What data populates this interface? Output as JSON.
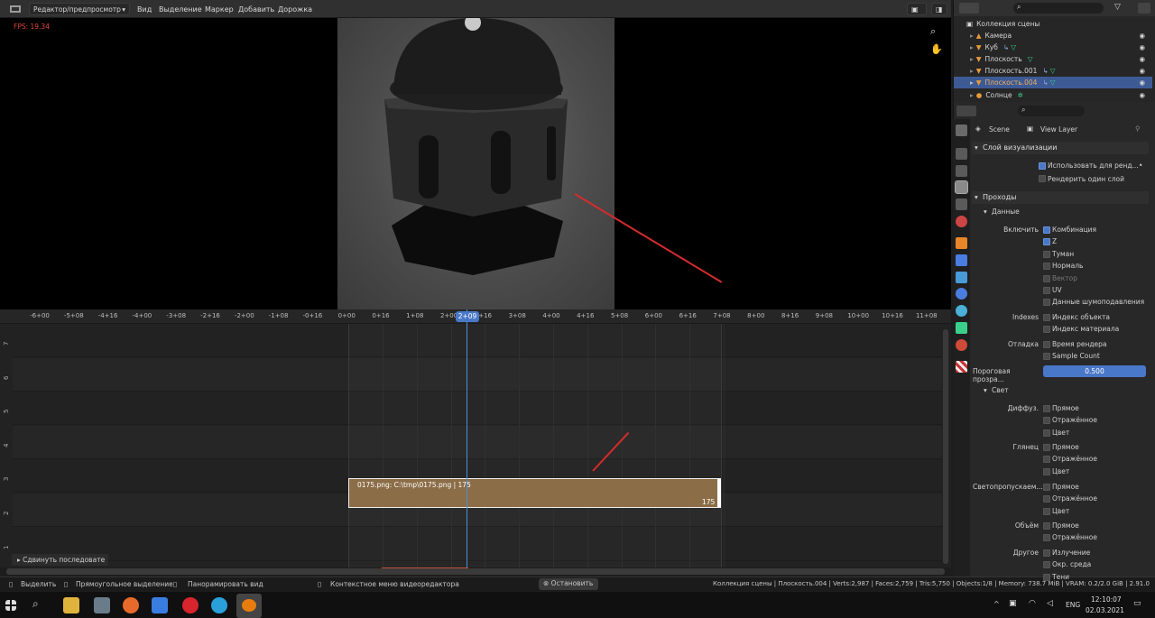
{
  "header": {
    "editor_mode": "Редактор/предпросмотр",
    "menu": [
      "Вид",
      "Выделение",
      "Маркер",
      "Добавить",
      "Дорожка"
    ]
  },
  "preview": {
    "fps": "FPS: 19.34"
  },
  "timeline": {
    "ticks": [
      "-6+00",
      "-5+08",
      "-4+16",
      "-4+00",
      "-3+08",
      "-2+16",
      "-2+00",
      "-1+08",
      "-0+16",
      "0+00",
      "0+16",
      "1+08",
      "2+00",
      "2+16",
      "3+08",
      "4+00",
      "4+16",
      "5+08",
      "6+00",
      "6+16",
      "7+08",
      "8+00",
      "8+16",
      "9+08",
      "10+00",
      "10+16",
      "11+08"
    ],
    "playhead": "2+09",
    "channels": [
      "7",
      "6",
      "5",
      "4",
      "3",
      "2",
      "1"
    ],
    "strip_label": "0175.png: C:\\tmp\\0175.png | 175",
    "strip_end": "175",
    "adjust_panel": "Сдвинуть последовате"
  },
  "status": {
    "select": "Выделить",
    "box": "Прямоугольное выделение",
    "pan": "Панорамировать вид",
    "context": "Контекстное меню видеоредактора",
    "stop": "Остановить",
    "stats": "Коллекция сцены | Плоскость.004 | Verts:2,987 | Faces:2,759 | Tris:5,750 | Objects:1/8 | Memory: 738.7 MiB | VRAM: 0.2/2.0 GiB | 2.91.0"
  },
  "taskbar": {
    "lang": "ENG",
    "time": "12:10:07",
    "date": "02.03.2021"
  },
  "outliner": {
    "root": "Коллекция сцены",
    "items": [
      "Камера",
      "Куб",
      "Плоскость",
      "Плоскость.001",
      "Плоскость.004",
      "Солнце"
    ],
    "selected": "Плоскость.004"
  },
  "properties": {
    "scene": "Scene",
    "view_layer": "View Layer",
    "sec_layer": "Слой визуализации",
    "use_render": "Использовать для ренд...",
    "render_single": "Рендерить один слой",
    "sec_passes": "Проходы",
    "sub_data": "Данные",
    "include": "Включить",
    "data_items": [
      "Комбинация",
      "Z",
      "Туман",
      "Нормаль",
      "Вектор",
      "UV",
      "Данные шумоподавления"
    ],
    "indexes": "Indexes",
    "index_items": [
      "Индекс объекта",
      "Индекс материала"
    ],
    "debug": "Отладка",
    "debug_items": [
      "Время рендера",
      "Sample Count"
    ],
    "alpha_label": "Пороговая прозра...",
    "alpha_value": "0.500",
    "sub_light": "Свет",
    "diffuse": "Диффуз.",
    "glossy": "Глянец",
    "transmission": "Светопропускаем...",
    "volume": "Объём",
    "other": "Другое",
    "light_items": [
      "Прямое",
      "Отражённое",
      "Цвет"
    ],
    "volume_items": [
      "Прямое",
      "Отражённое"
    ],
    "other_items": [
      "Излучение",
      "Окр. среда",
      "Тени"
    ]
  }
}
